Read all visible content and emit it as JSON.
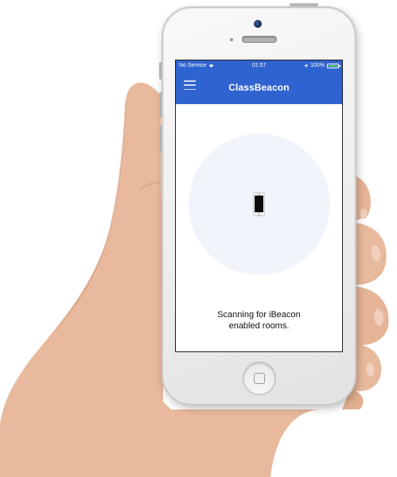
{
  "status_bar": {
    "carrier": "No Service",
    "time": "01:57",
    "battery": "100%",
    "wifi_icon": "wifi-icon",
    "location_icon": "location-arrow-icon",
    "battery_icon": "battery-full-icon"
  },
  "nav_bar": {
    "title": "ClassBeacon",
    "menu_icon": "hamburger-menu-icon",
    "color": "#2f63d0"
  },
  "main": {
    "device_icon": "phone-icon",
    "scan_line1": "Scanning for iBeacon",
    "scan_line2": "enabled rooms."
  }
}
